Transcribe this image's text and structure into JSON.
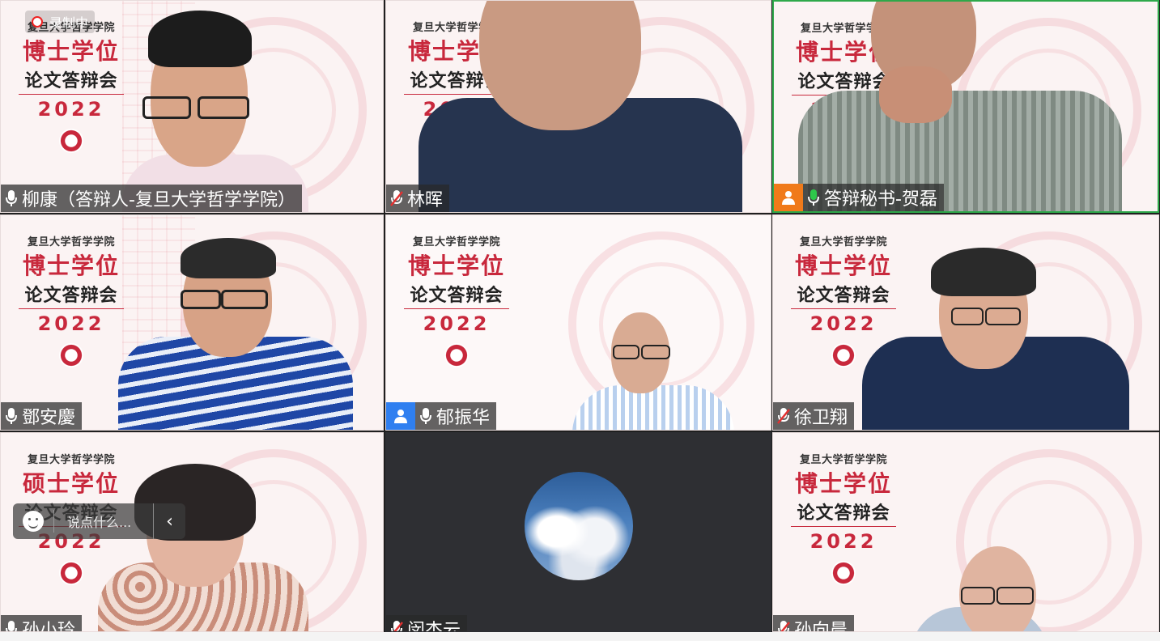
{
  "recording": {
    "label": "录制中"
  },
  "chat": {
    "placeholder": "说点什么...",
    "collapse_icon": "chevron-left-icon"
  },
  "banner": {
    "school": "复旦大学哲学学院",
    "doctor": "博士学位",
    "master": "硕士学位",
    "defense": "论文答辩会",
    "year": "2022"
  },
  "participants": [
    {
      "name": "柳康（答辩人-复旦大学哲学学院）",
      "mic": "on",
      "badge": "none"
    },
    {
      "name": "林晖",
      "mic": "muted",
      "badge": "none"
    },
    {
      "name": "答辩秘书-贺磊",
      "mic": "speaking",
      "badge": "host"
    },
    {
      "name": "鄧安慶",
      "mic": "on",
      "badge": "none"
    },
    {
      "name": "郁振华",
      "mic": "on",
      "badge": "cohost"
    },
    {
      "name": "徐卫翔",
      "mic": "muted",
      "badge": "none"
    },
    {
      "name": "孙小玲",
      "mic": "on",
      "badge": "none"
    },
    {
      "name": "闵杰云",
      "mic": "muted",
      "badge": "none"
    },
    {
      "name": "孙向晨",
      "mic": "muted",
      "badge": "none"
    }
  ],
  "colors": {
    "accent_red": "#c8283c",
    "speaking_green": "#2ea84a",
    "host_orange": "#f07a1a",
    "cohost_blue": "#2f7ff0"
  }
}
